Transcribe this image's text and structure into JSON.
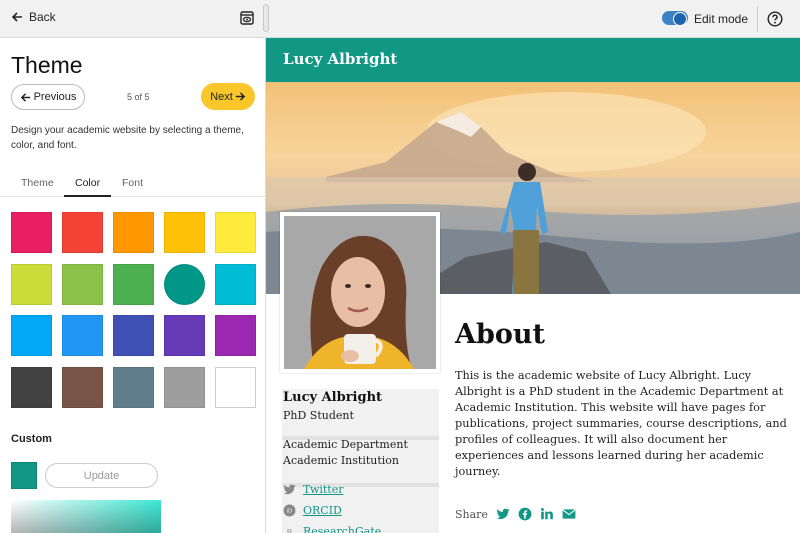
{
  "topbar": {
    "back_label": "Back",
    "edit_mode_label": "Edit mode",
    "edit_mode_on": true
  },
  "panel": {
    "title": "Theme",
    "prev_label": "Previous",
    "next_label": "Next",
    "step": "5 of 5",
    "description": "Design your academic website by selecting a theme, color, and font.",
    "tabs": [
      {
        "label": "Theme",
        "active": false
      },
      {
        "label": "Color",
        "active": true
      },
      {
        "label": "Font",
        "active": false
      }
    ],
    "swatches": [
      "#e91e63",
      "#f44336",
      "#ff9800",
      "#ffc107",
      "#ffeb3b",
      "#cddc39",
      "#8bc34a",
      "#4caf50",
      "#009688",
      "#00bcd4",
      "#03a9f4",
      "#2196f3",
      "#3f51b5",
      "#673ab7",
      "#9c27b0",
      "#424242",
      "#795548",
      "#607d8b",
      "#9e9e9e",
      "#ffffff"
    ],
    "selected_swatch_index": 8,
    "custom_label": "Custom",
    "custom_color": "#119784",
    "update_label": "Update"
  },
  "site": {
    "header_title": "Lucy Albright",
    "accent_color": "#119784",
    "profile": {
      "name": "Lucy Albright",
      "role": "PhD Student",
      "department": "Academic Department",
      "institution": "Academic Institution",
      "links": [
        {
          "label": "Twitter",
          "icon": "twitter-icon"
        },
        {
          "label": "ORCID",
          "icon": "orcid-icon"
        },
        {
          "label": "ResearchGate",
          "icon": "researchgate-icon"
        }
      ]
    },
    "about": {
      "title": "About",
      "text": "This is the academic website of Lucy Albright. Lucy Albright is a PhD student in the Academic Department at Academic Institution. This website will have pages for publications, project summaries, course descriptions, and profiles of colleagues. It will also document her experiences and lessons learned during her academic journey."
    },
    "share_label": "Share",
    "share_icons": [
      "twitter-icon",
      "facebook-icon",
      "linkedin-icon",
      "email-icon"
    ]
  }
}
